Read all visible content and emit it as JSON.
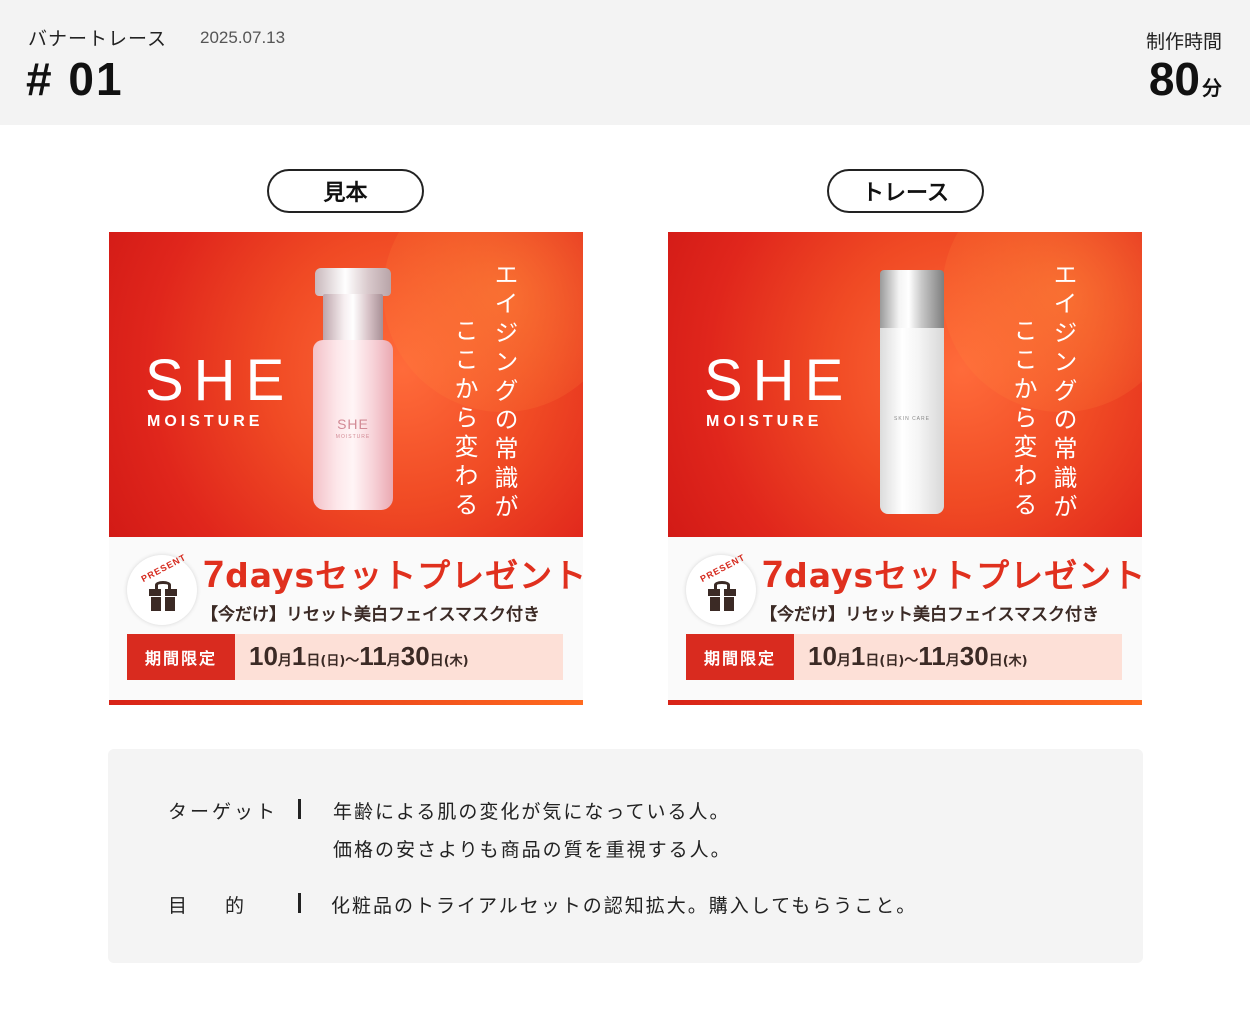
{
  "header": {
    "series_label": "バナートレース",
    "date": "2025.07.13",
    "number": "# 01",
    "time_label": "制作時間",
    "time_value": "80",
    "time_unit": "分"
  },
  "labels": {
    "sample": "見本",
    "trace": "トレース"
  },
  "banner": {
    "brand": "SHE",
    "brand_sub": "MOISTURE",
    "tagline_line1": "エイジングの常識が",
    "tagline_line2": "ここから変わる",
    "present_badge": "PRESENT",
    "promo_num": "7",
    "promo_days": "days",
    "promo_rest": "セットプレゼント",
    "promo_sub": "【今だけ】リセット美白フェイスマスク付き",
    "period_tag": "期間限定",
    "start_month": "10",
    "month_unit": "月",
    "start_day": "1",
    "day_unit": "日",
    "start_weekday": "(日)",
    "tilde": "～",
    "end_month": "11",
    "end_day": "30",
    "end_weekday": "(木)",
    "sample_bottle_label": "SHE",
    "sample_bottle_sublabel": "MOISTURE",
    "trace_bottle_label": "SKIN CARE"
  },
  "info": {
    "target_label": "ターゲット",
    "target_line1": "年齢による肌の変化が気になっている人。",
    "target_line2": "価格の安さよりも商品の質を重視する人。",
    "purpose_label": "目　　的",
    "purpose_text": "化粧品のトライアルセットの認知拡大。購入してもらうこと。"
  },
  "colors": {
    "accent_red": "#d92b1f",
    "accent_orange": "#ff6a1f",
    "header_bg": "#f3f3f3",
    "info_bg": "#f4f4f4"
  }
}
